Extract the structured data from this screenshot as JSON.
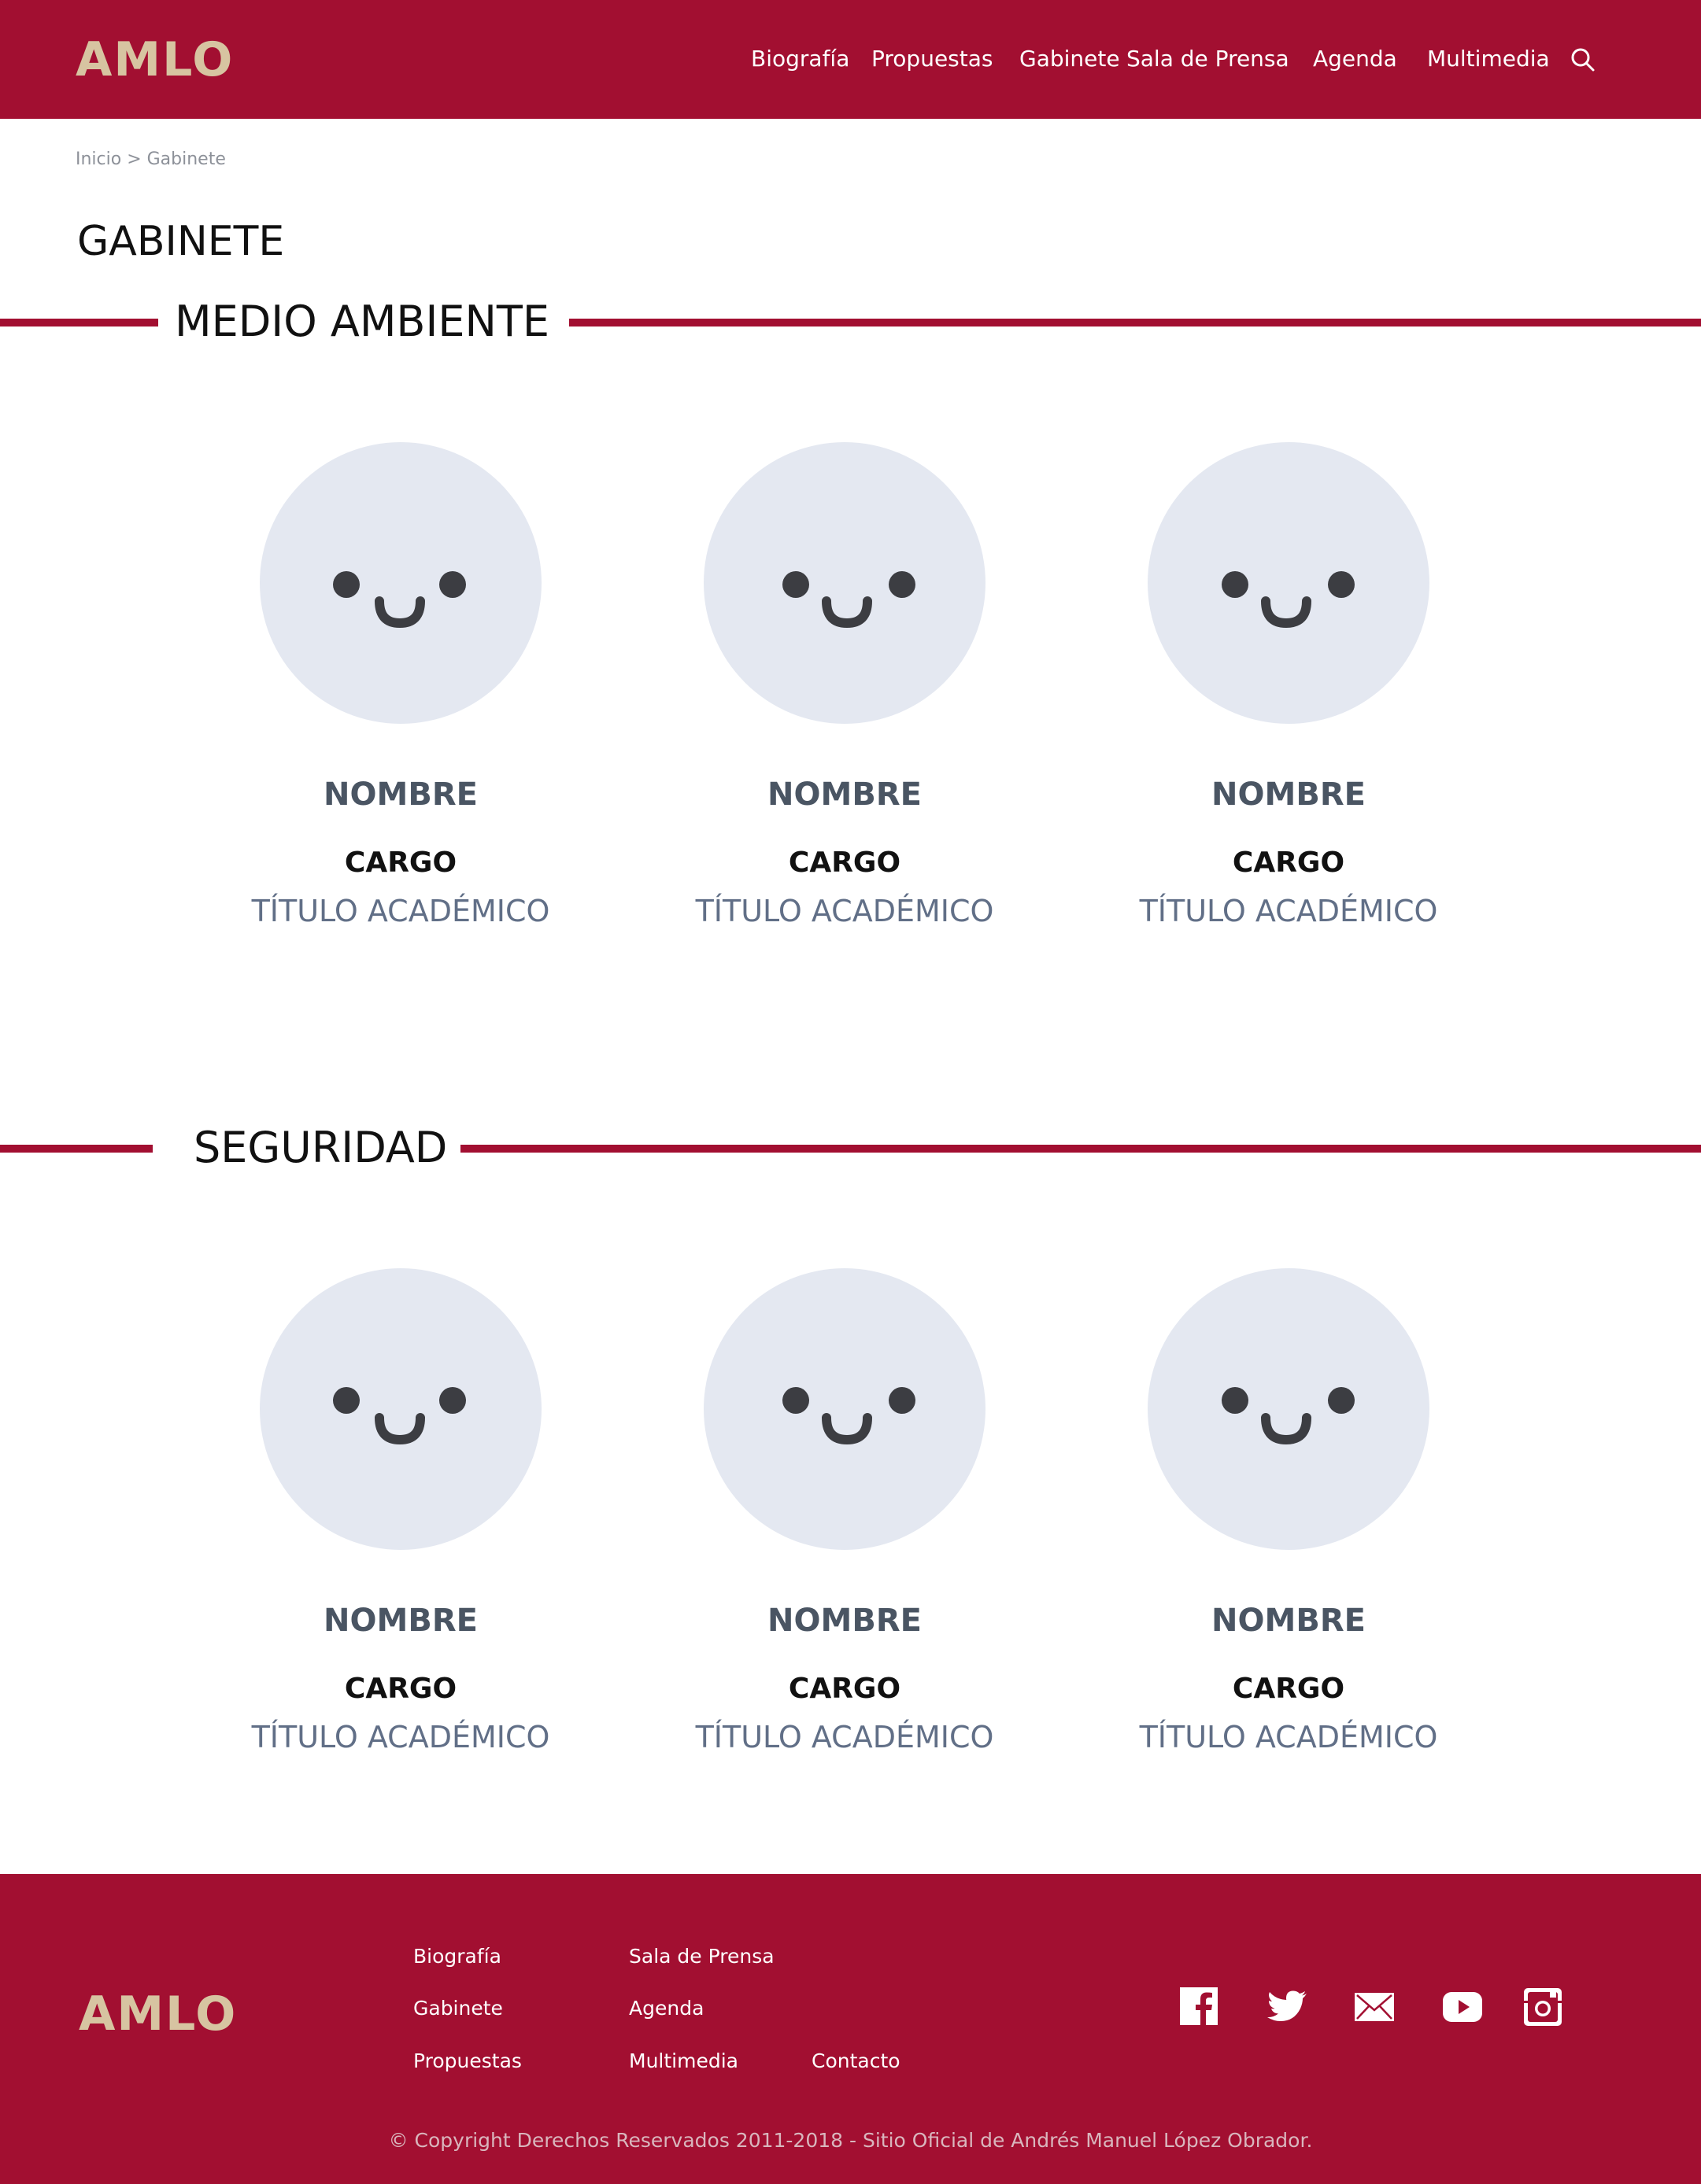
{
  "header": {
    "logo": "AMLO",
    "nav": [
      "Biografía",
      "Propuestas",
      "Gabinete",
      "Sala de Prensa",
      "Agenda",
      "Multimedia"
    ],
    "search_icon": "search-icon"
  },
  "breadcrumb": "Inicio > Gabinete",
  "page_title": "GABINETE",
  "sections": [
    {
      "title": "MEDIO AMBIENTE",
      "members": [
        {
          "name": "NOMBRE",
          "cargo": "CARGO",
          "titulo": "TÍTULO ACADÉMICO",
          "avatar_icon": "smiley-placeholder-icon"
        },
        {
          "name": "NOMBRE",
          "cargo": "CARGO",
          "titulo": "TÍTULO ACADÉMICO",
          "avatar_icon": "smiley-placeholder-icon"
        },
        {
          "name": "NOMBRE",
          "cargo": "CARGO",
          "titulo": "TÍTULO ACADÉMICO",
          "avatar_icon": "smiley-placeholder-icon"
        }
      ]
    },
    {
      "title": "SEGURIDAD",
      "members": [
        {
          "name": "NOMBRE",
          "cargo": "CARGO",
          "titulo": "TÍTULO ACADÉMICO",
          "avatar_icon": "smiley-placeholder-icon"
        },
        {
          "name": "NOMBRE",
          "cargo": "CARGO",
          "titulo": "TÍTULO ACADÉMICO",
          "avatar_icon": "smiley-placeholder-icon"
        },
        {
          "name": "NOMBRE",
          "cargo": "CARGO",
          "titulo": "TÍTULO ACADÉMICO",
          "avatar_icon": "smiley-placeholder-icon"
        }
      ]
    }
  ],
  "footer": {
    "logo": "AMLO",
    "links": [
      "Biografía",
      "Gabinete",
      "Propuestas",
      "Sala de Prensa",
      "Agenda",
      "Multimedia",
      "Contacto"
    ],
    "social_icons": [
      "facebook-icon",
      "twitter-icon",
      "email-icon",
      "youtube-icon",
      "instagram-icon"
    ],
    "copyright": "© Copyright Derechos Reservados 2011-2018 - Sitio Oficial de Andrés Manuel López Obrador."
  },
  "colors": {
    "brand": "#a20f31",
    "logo": "#d7c4a1",
    "avatar_bg": "#e4e8f1",
    "name_text": "#4a5563",
    "titulo_text": "#616f87"
  }
}
